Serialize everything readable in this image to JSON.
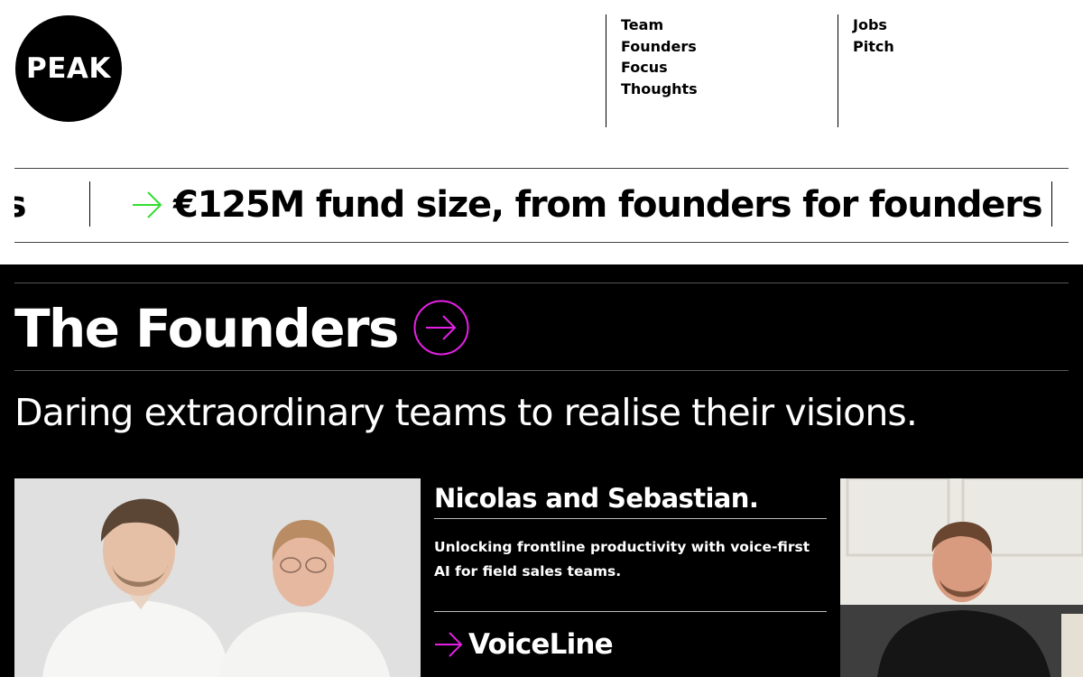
{
  "brand": {
    "logo_text": "PEAK"
  },
  "nav": {
    "col1": [
      "Team",
      "Founders",
      "Focus",
      "Thoughts"
    ],
    "col2": [
      "Jobs",
      "Pitch"
    ]
  },
  "ticker": {
    "prev_fragment": "urs",
    "main_text": "€125M fund size, from founders for founders",
    "arrow_color": "#33dd33"
  },
  "section": {
    "title": "The Founders",
    "tagline": "Daring extraordinary teams to realise their visions.",
    "accent_color": "#e620e6"
  },
  "founders": [
    {
      "name": "Nicolas and Sebastian.",
      "description": "Unlocking frontline productivity with voice-first AI for field sales teams.",
      "company": "VoiceLine"
    }
  ]
}
